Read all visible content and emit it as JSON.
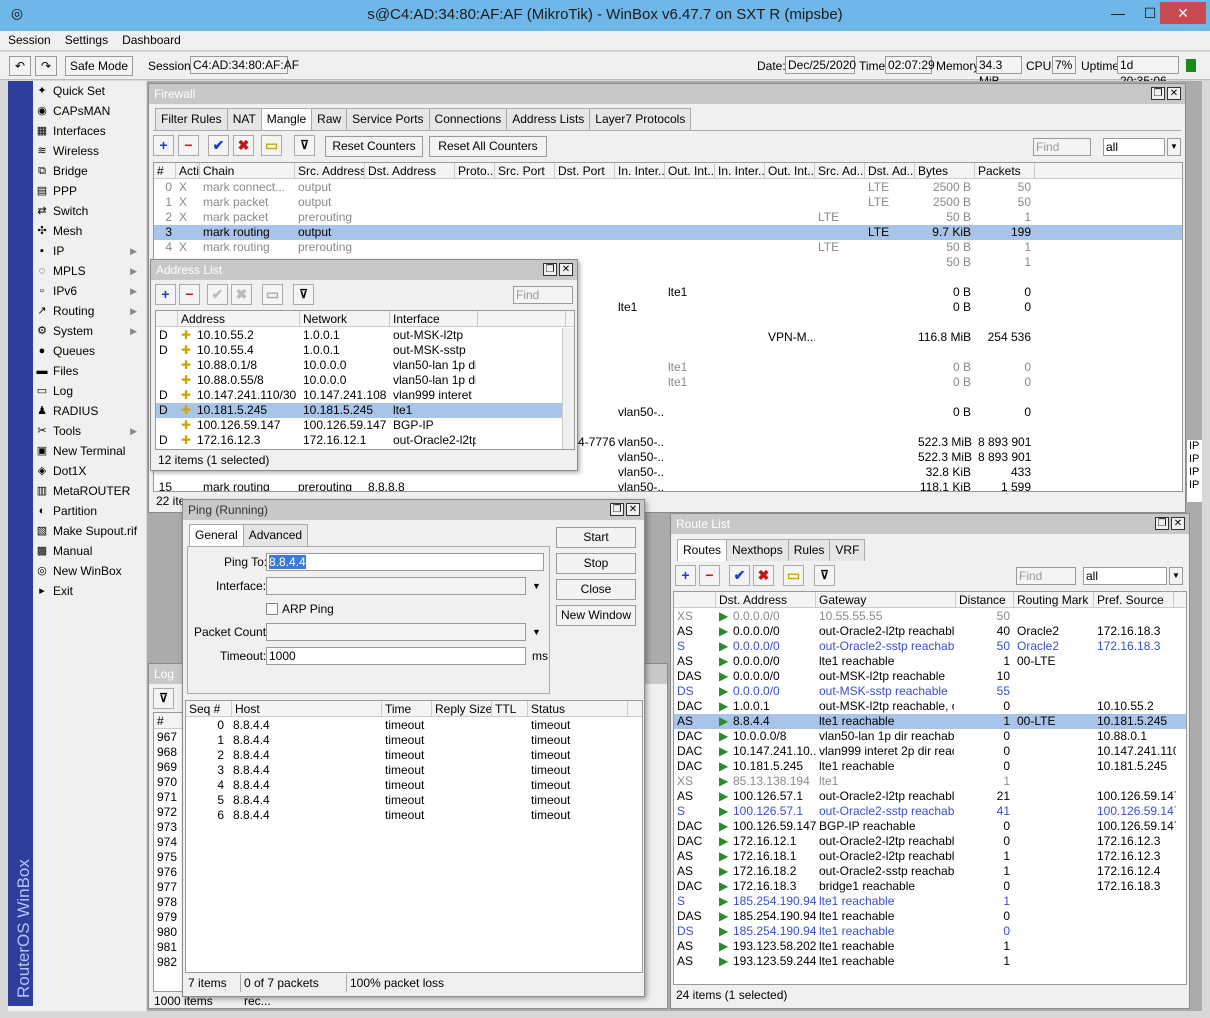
{
  "window": {
    "title": "s@C4:AD:34:80:AF:AF (MikroTik) - WinBox v6.47.7 on SXT R (mipsbe)"
  },
  "menu": [
    "Session",
    "Settings",
    "Dashboard"
  ],
  "toolbar": {
    "safe_mode": "Safe Mode",
    "session_label": "Session:",
    "session_value": "C4:AD:34:80:AF:AF",
    "date_label": "Date:",
    "date": "Dec/25/2020",
    "time_label": "Time:",
    "time": "02:07:29",
    "memory_label": "Memory:",
    "memory": "34.3 MiB",
    "cpu_label": "CPU:",
    "cpu": "7%",
    "uptime_label": "Uptime:",
    "uptime": "1d 20:35:06"
  },
  "brand": "RouterOS WinBox",
  "sidebar": [
    {
      "label": "Quick Set",
      "icon": "wand-icon"
    },
    {
      "label": "CAPsMAN",
      "icon": "capsman-icon"
    },
    {
      "label": "Interfaces",
      "icon": "interfaces-icon"
    },
    {
      "label": "Wireless",
      "icon": "wireless-icon"
    },
    {
      "label": "Bridge",
      "icon": "bridge-icon"
    },
    {
      "label": "PPP",
      "icon": "ppp-icon"
    },
    {
      "label": "Switch",
      "icon": "switch-icon"
    },
    {
      "label": "Mesh",
      "icon": "mesh-icon"
    },
    {
      "label": "IP",
      "icon": "ip-icon",
      "sub": true
    },
    {
      "label": "MPLS",
      "icon": "mpls-icon",
      "sub": true
    },
    {
      "label": "IPv6",
      "icon": "ipv6-icon",
      "sub": true
    },
    {
      "label": "Routing",
      "icon": "routing-icon",
      "sub": true
    },
    {
      "label": "System",
      "icon": "system-icon",
      "sub": true
    },
    {
      "label": "Queues",
      "icon": "queues-icon"
    },
    {
      "label": "Files",
      "icon": "files-icon"
    },
    {
      "label": "Log",
      "icon": "log-icon"
    },
    {
      "label": "RADIUS",
      "icon": "radius-icon"
    },
    {
      "label": "Tools",
      "icon": "tools-icon",
      "sub": true
    },
    {
      "label": "New Terminal",
      "icon": "terminal-icon"
    },
    {
      "label": "Dot1X",
      "icon": "dot1x-icon"
    },
    {
      "label": "MetaROUTER",
      "icon": "metarouter-icon"
    },
    {
      "label": "Partition",
      "icon": "partition-icon"
    },
    {
      "label": "Make Supout.rif",
      "icon": "supout-icon"
    },
    {
      "label": "Manual",
      "icon": "manual-icon"
    },
    {
      "label": "New WinBox",
      "icon": "winbox-icon"
    },
    {
      "label": "Exit",
      "icon": "exit-icon"
    }
  ],
  "firewall": {
    "title": "Firewall",
    "tabs": [
      "Filter Rules",
      "NAT",
      "Mangle",
      "Raw",
      "Service Ports",
      "Connections",
      "Address Lists",
      "Layer7 Protocols"
    ],
    "reset_counters": "Reset Counters",
    "reset_all": "Reset All Counters",
    "find": "Find",
    "filter": "all",
    "columns": [
      "#",
      "Action",
      "Chain",
      "Src. Address",
      "Dst. Address",
      "Proto...",
      "Src. Port",
      "Dst. Port",
      "In. Inter...",
      "Out. Int...",
      "In. Inter...",
      "Out. Int...",
      "Src. Ad...",
      "Dst. Ad...",
      "Bytes",
      "Packets"
    ],
    "rows": [
      {
        "n": "0",
        "x": "X",
        "action": "mark connect...",
        "chain": "output",
        "dstad": "LTE",
        "bytes": "2500 B",
        "packets": "50",
        "gray": true
      },
      {
        "n": "1",
        "x": "X",
        "action": "mark packet",
        "chain": "output",
        "dstad": "LTE",
        "bytes": "2500 B",
        "packets": "50",
        "gray": true
      },
      {
        "n": "2",
        "x": "X",
        "action": "mark packet",
        "chain": "prerouting",
        "srcad": "LTE",
        "bytes": "50 B",
        "packets": "1",
        "gray": true
      },
      {
        "n": "3",
        "action": "mark routing",
        "chain": "output",
        "dstad": "LTE",
        "bytes": "9.7 KiB",
        "packets": "199",
        "sel": true
      },
      {
        "n": "4",
        "x": "X",
        "action": "mark routing",
        "chain": "prerouting",
        "srcad": "LTE",
        "bytes": "50 B",
        "packets": "1",
        "gray": true
      },
      {
        "bytes": "50 B",
        "packets": "1",
        "gray": true
      },
      {},
      {
        "outint": "lte1",
        "bytes": "0 B",
        "packets": "0"
      },
      {
        "inint": "lte1",
        "bytes": "0 B",
        "packets": "0"
      },
      {},
      {
        "outint2": "VPN-M...",
        "bytes": "116.8 MiB",
        "packets": "254 536"
      },
      {},
      {
        "outint": "lte1",
        "bytes": "0 B",
        "packets": "0",
        "gray": true
      },
      {
        "outint": "lte1",
        "bytes": "0 B",
        "packets": "0",
        "gray": true
      },
      {},
      {
        "inint": "vlan50-...",
        "bytes": "0 B",
        "packets": "0"
      },
      {},
      {
        "dstport": "7774-7776",
        "inint": "vlan50-...",
        "bytes": "522.3 MiB",
        "packets": "8 893 901"
      },
      {
        "inint": "vlan50-...",
        "bytes": "522.3 MiB",
        "packets": "8 893 901"
      },
      {
        "inint": "vlan50-...",
        "bytes": "32.8 KiB",
        "packets": "433"
      },
      {
        "n": "15",
        "action": "mark routing",
        "chain": "prerouting",
        "dst": "8.8.8.8",
        "inint": "vlan50-...",
        "bytes": "118.1 KiB",
        "packets": "1 599"
      }
    ],
    "status": "22 ite"
  },
  "address_list": {
    "title": "Address List",
    "find": "Find",
    "columns": [
      "Address",
      "Network",
      "Interface"
    ],
    "rows": [
      {
        "f": "D",
        "addr": "10.10.55.2",
        "net": "1.0.0.1",
        "iface": "out-MSK-l2tp"
      },
      {
        "f": "D",
        "addr": "10.10.55.4",
        "net": "1.0.0.1",
        "iface": "out-MSK-sstp"
      },
      {
        "f": "",
        "addr": "10.88.0.1/8",
        "net": "10.0.0.0",
        "iface": "vlan50-lan 1p dir"
      },
      {
        "f": "",
        "addr": "10.88.0.55/8",
        "net": "10.0.0.0",
        "iface": "vlan50-lan 1p dir"
      },
      {
        "f": "D",
        "addr": "10.147.241.110/30",
        "net": "10.147.241.108",
        "iface": "vlan999 interet ..."
      },
      {
        "f": "D",
        "addr": "10.181.5.245",
        "net": "10.181.5.245",
        "iface": "lte1",
        "sel": true
      },
      {
        "f": "",
        "addr": "100.126.59.147",
        "net": "100.126.59.147",
        "iface": "BGP-IP"
      },
      {
        "f": "D",
        "addr": "172.16.12.3",
        "net": "172.16.12.1",
        "iface": "out-Oracle2-l2tp"
      }
    ],
    "status": "12 items (1 selected)"
  },
  "ping": {
    "title": "Ping (Running)",
    "tabs": [
      "General",
      "Advanced"
    ],
    "ping_to_label": "Ping To:",
    "ping_to": "8.8.4.4",
    "interface_label": "Interface:",
    "arp_ping": "ARP Ping",
    "packet_count_label": "Packet Count:",
    "timeout_label": "Timeout:",
    "timeout": "1000",
    "timeout_unit": "ms",
    "start": "Start",
    "stop": "Stop",
    "close": "Close",
    "new_window": "New Window",
    "columns": [
      "Seq #",
      "Host",
      "Time",
      "Reply Size",
      "TTL",
      "Status"
    ],
    "rows": [
      {
        "seq": "0",
        "host": "8.8.4.4",
        "time": "timeout",
        "status": "timeout"
      },
      {
        "seq": "1",
        "host": "8.8.4.4",
        "time": "timeout",
        "status": "timeout"
      },
      {
        "seq": "2",
        "host": "8.8.4.4",
        "time": "timeout",
        "status": "timeout"
      },
      {
        "seq": "3",
        "host": "8.8.4.4",
        "time": "timeout",
        "status": "timeout"
      },
      {
        "seq": "4",
        "host": "8.8.4.4",
        "time": "timeout",
        "status": "timeout"
      },
      {
        "seq": "5",
        "host": "8.8.4.4",
        "time": "timeout",
        "status": "timeout"
      },
      {
        "seq": "6",
        "host": "8.8.4.4",
        "time": "timeout",
        "status": "timeout"
      }
    ],
    "status1": "7 items",
    "status2": "0 of 7 packets rec...",
    "status3": "100% packet loss"
  },
  "log": {
    "title": "Log",
    "rows": [
      "967",
      "968",
      "969",
      "970",
      "971",
      "972",
      "973",
      "974",
      "975",
      "976",
      "977",
      "978",
      "979",
      "980",
      "981",
      "982"
    ],
    "status": "1000 items",
    "hash": "#"
  },
  "route": {
    "title": "Route List",
    "tabs": [
      "Routes",
      "Nexthops",
      "Rules",
      "VRF"
    ],
    "find": "Find",
    "filter": "all",
    "columns": [
      "Dst. Address",
      "Gateway",
      "Distance",
      "Routing Mark",
      "Pref. Source"
    ],
    "rows": [
      {
        "f": "XS",
        "dst": "0.0.0.0/0",
        "gw": "10.55.55.55",
        "dist": "50",
        "c": "gray"
      },
      {
        "f": "AS",
        "dst": "0.0.0.0/0",
        "gw": "out-Oracle2-l2tp reachable",
        "dist": "40",
        "mark": "Oracle2",
        "pref": "172.16.18.3"
      },
      {
        "f": "S",
        "dst": "0.0.0.0/0",
        "gw": "out-Oracle2-sstp reachable",
        "dist": "50",
        "mark": "Oracle2",
        "pref": "172.16.18.3",
        "c": "blue"
      },
      {
        "f": "AS",
        "dst": "0.0.0.0/0",
        "gw": "lte1 reachable",
        "dist": "1",
        "mark": "00-LTE"
      },
      {
        "f": "DAS",
        "dst": "0.0.0.0/0",
        "gw": "out-MSK-l2tp reachable",
        "dist": "10"
      },
      {
        "f": "DS",
        "dst": "0.0.0.0/0",
        "gw": "out-MSK-sstp reachable",
        "dist": "55",
        "c": "blue"
      },
      {
        "f": "DAC",
        "dst": "1.0.0.1",
        "gw": "out-MSK-l2tp reachable, o...",
        "dist": "0",
        "pref": "10.10.55.2"
      },
      {
        "f": "AS",
        "dst": "8.8.4.4",
        "gw": "lte1 reachable",
        "dist": "1",
        "mark": "00-LTE",
        "pref": "10.181.5.245",
        "sel": true
      },
      {
        "f": "DAC",
        "dst": "10.0.0.0/8",
        "gw": "vlan50-lan 1p dir reachable",
        "dist": "0",
        "pref": "10.88.0.1"
      },
      {
        "f": "DAC",
        "dst": "10.147.241.10...",
        "gw": "vlan999 interet 2p dir reac...",
        "dist": "0",
        "pref": "10.147.241.110"
      },
      {
        "f": "DAC",
        "dst": "10.181.5.245",
        "gw": "lte1 reachable",
        "dist": "0",
        "pref": "10.181.5.245"
      },
      {
        "f": "XS",
        "dst": "85.13.138.194",
        "gw": "lte1",
        "dist": "1",
        "c": "gray"
      },
      {
        "f": "AS",
        "dst": "100.126.57.1",
        "gw": "out-Oracle2-l2tp reachable",
        "dist": "21",
        "pref": "100.126.59.147"
      },
      {
        "f": "S",
        "dst": "100.126.57.1",
        "gw": "out-Oracle2-sstp reachable",
        "dist": "41",
        "pref": "100.126.59.147",
        "c": "blue"
      },
      {
        "f": "DAC",
        "dst": "100.126.59.147",
        "gw": "BGP-IP reachable",
        "dist": "0",
        "pref": "100.126.59.147"
      },
      {
        "f": "DAC",
        "dst": "172.16.12.1",
        "gw": "out-Oracle2-l2tp reachabl...",
        "dist": "0",
        "pref": "172.16.12.3"
      },
      {
        "f": "AS",
        "dst": "172.16.18.1",
        "gw": "out-Oracle2-l2tp reachable",
        "dist": "1",
        "pref": "172.16.12.3"
      },
      {
        "f": "AS",
        "dst": "172.16.18.2",
        "gw": "out-Oracle2-sstp reachable",
        "dist": "1",
        "pref": "172.16.12.4"
      },
      {
        "f": "DAC",
        "dst": "172.16.18.3",
        "gw": "bridge1 reachable",
        "dist": "0",
        "pref": "172.16.18.3"
      },
      {
        "f": "S",
        "dst": "185.254.190.94",
        "gw": "lte1 reachable",
        "dist": "1",
        "c": "blue"
      },
      {
        "f": "DAS",
        "dst": "185.254.190.94",
        "gw": "lte1 reachable",
        "dist": "0"
      },
      {
        "f": "DS",
        "dst": "185.254.190.94",
        "gw": "lte1 reachable",
        "dist": "0",
        "c": "blue"
      },
      {
        "f": "AS",
        "dst": "193.123.58.202",
        "gw": "lte1 reachable",
        "dist": "1"
      },
      {
        "f": "AS",
        "dst": "193.123.59.244",
        "gw": "lte1 reachable",
        "dist": "1"
      }
    ],
    "status": "24 items (1 selected)"
  },
  "right_edge": [
    "IP",
    "IP",
    "IP",
    "IP"
  ]
}
